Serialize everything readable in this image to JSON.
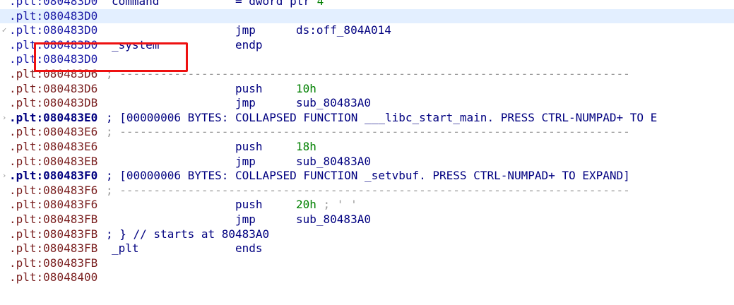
{
  "colors": {
    "address": "#1a1aa6",
    "address_dark": "#7a1f1f",
    "mnemonic": "#000080",
    "number": "#008000",
    "comment": "#9a9a9a",
    "highlight": "#e3efff",
    "annotation_box": "#ee1111"
  },
  "lines": [
    {
      "seg": ".plt",
      "off": "080483D0",
      "name": "command",
      "eq": "= dword ptr",
      "eq_num": "4"
    },
    {
      "seg": ".plt",
      "off": "080483D0",
      "hl": true
    },
    {
      "seg": ".plt",
      "off": "080483D0",
      "marker": "✓",
      "op": "jmp",
      "opnd": "ds:off_804A014"
    },
    {
      "seg": ".plt",
      "off": "080483D0",
      "name": "_system",
      "op": "endp"
    },
    {
      "seg": ".plt",
      "off": "080483D0"
    },
    {
      "seg": ".plt",
      "off": "080483D6",
      "dark": true,
      "dashes": "; ---------------------------------------------------------------------------"
    },
    {
      "seg": ".plt",
      "off": "080483D6",
      "dark": true,
      "op": "push",
      "opnd": "10h",
      "num": true
    },
    {
      "seg": ".plt",
      "off": "080483DB",
      "dark": true,
      "op": "jmp",
      "opnd": "sub_80483A0"
    },
    {
      "seg": ".plt",
      "off": "080483E0",
      "marker": "›",
      "collapsed": true,
      "rest": "; [00000006 BYTES: COLLAPSED FUNCTION ___libc_start_main. PRESS CTRL-NUMPAD+ TO E"
    },
    {
      "seg": ".plt",
      "off": "080483E6",
      "dark": true,
      "dashes": "; ---------------------------------------------------------------------------"
    },
    {
      "seg": ".plt",
      "off": "080483E6",
      "dark": true,
      "op": "push",
      "opnd": "18h",
      "num": true
    },
    {
      "seg": ".plt",
      "off": "080483EB",
      "dark": true,
      "op": "jmp",
      "opnd": "sub_80483A0"
    },
    {
      "seg": ".plt",
      "off": "080483F0",
      "marker": "›",
      "collapsed": true,
      "rest": "; [00000006 BYTES: COLLAPSED FUNCTION _setvbuf. PRESS CTRL-NUMPAD+ TO EXPAND]"
    },
    {
      "seg": ".plt",
      "off": "080483F6",
      "dark": true,
      "dashes": "; ---------------------------------------------------------------------------"
    },
    {
      "seg": ".plt",
      "off": "080483F6",
      "dark": true,
      "op": "push",
      "opnd": "20h",
      "num": true,
      "opnd_cmt": " ; ' '"
    },
    {
      "seg": ".plt",
      "off": "080483FB",
      "dark": true,
      "op": "jmp",
      "opnd": "sub_80483A0"
    },
    {
      "seg": ".plt",
      "off": "080483FB",
      "dark": true,
      "rest": "; } // starts at 80483A0"
    },
    {
      "seg": ".plt",
      "off": "080483FB",
      "dark": true,
      "name": "_plt",
      "op": "ends"
    },
    {
      "seg": ".plt",
      "off": "080483FB",
      "dark": true
    },
    {
      "seg": ".plt",
      "off": "08048400",
      "dark": true
    }
  ]
}
